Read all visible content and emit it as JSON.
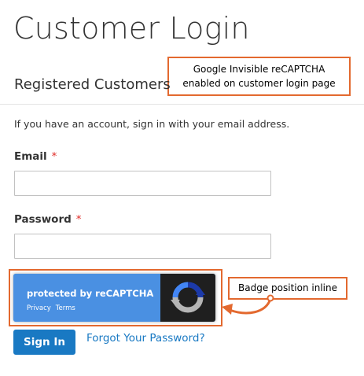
{
  "page": {
    "title": "Customer Login"
  },
  "section": {
    "title": "Registered Customers",
    "intro": "If you have an account, sign in with your email address."
  },
  "form": {
    "email": {
      "label": "Email",
      "required_mark": "*",
      "value": "",
      "placeholder": ""
    },
    "password": {
      "label": "Password",
      "required_mark": "*",
      "value": "",
      "placeholder": ""
    },
    "signin_label": "Sign In",
    "forgot_label": "Forgot Your Password?"
  },
  "recaptcha_badge": {
    "protected_text": "protected by reCAPTCHA",
    "privacy_label": "Privacy",
    "terms_label": "Terms",
    "logo_icon": "recaptcha-logo-icon"
  },
  "annotations": {
    "recaptcha_callout": {
      "line1": "Google Invisible reCAPTCHA",
      "line2": "enabled on customer login page"
    },
    "badge_callout": "Badge position inline",
    "arrow_icon": "curved-arrow-icon"
  },
  "colors": {
    "accent_orange": "#e3692f",
    "link_blue": "#1979c3",
    "button_blue": "#1979c3",
    "badge_blue": "#4a90e2",
    "badge_dark": "#1f1f1f",
    "required_red": "#e02b27",
    "text": "#333333"
  }
}
